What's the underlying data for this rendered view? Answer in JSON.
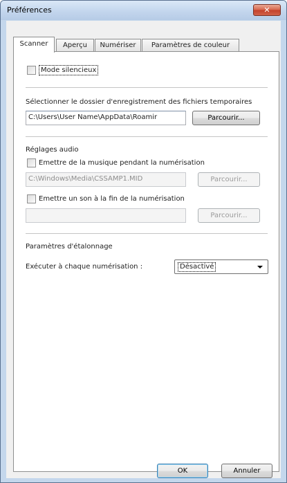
{
  "window": {
    "title": "Préférences",
    "close_label": "✕"
  },
  "tabs": [
    {
      "label": "Scanner",
      "active": true
    },
    {
      "label": "Aperçu",
      "active": false
    },
    {
      "label": "Numériser",
      "active": false
    },
    {
      "label": "Paramètres de couleur",
      "active": false
    }
  ],
  "scanner": {
    "silent_mode_label": "Mode silencieux",
    "temp_folder_label": "Sélectionner le dossier d'enregistrement des fichiers temporaires",
    "temp_folder_value": "C:\\Users\\User Name\\AppData\\Roamir",
    "browse_label": "Parcourir...",
    "audio_section_label": "Réglages audio",
    "music_checkbox_label": "Emettre de la musique pendant la numérisation",
    "music_path_value": "C:\\Windows\\Media\\CSSAMP1.MID",
    "browse_music_label": "Parcourir...",
    "sound_checkbox_label": "Emettre un son à la fin de la numérisation",
    "sound_path_value": "",
    "browse_sound_label": "Parcourir...",
    "calibration_section_label": "Paramètres d'étalonnage",
    "calibration_run_label": "Exécuter à chaque numérisation :",
    "calibration_value": "Désactivé"
  },
  "footer": {
    "ok_label": "OK",
    "cancel_label": "Annuler"
  }
}
